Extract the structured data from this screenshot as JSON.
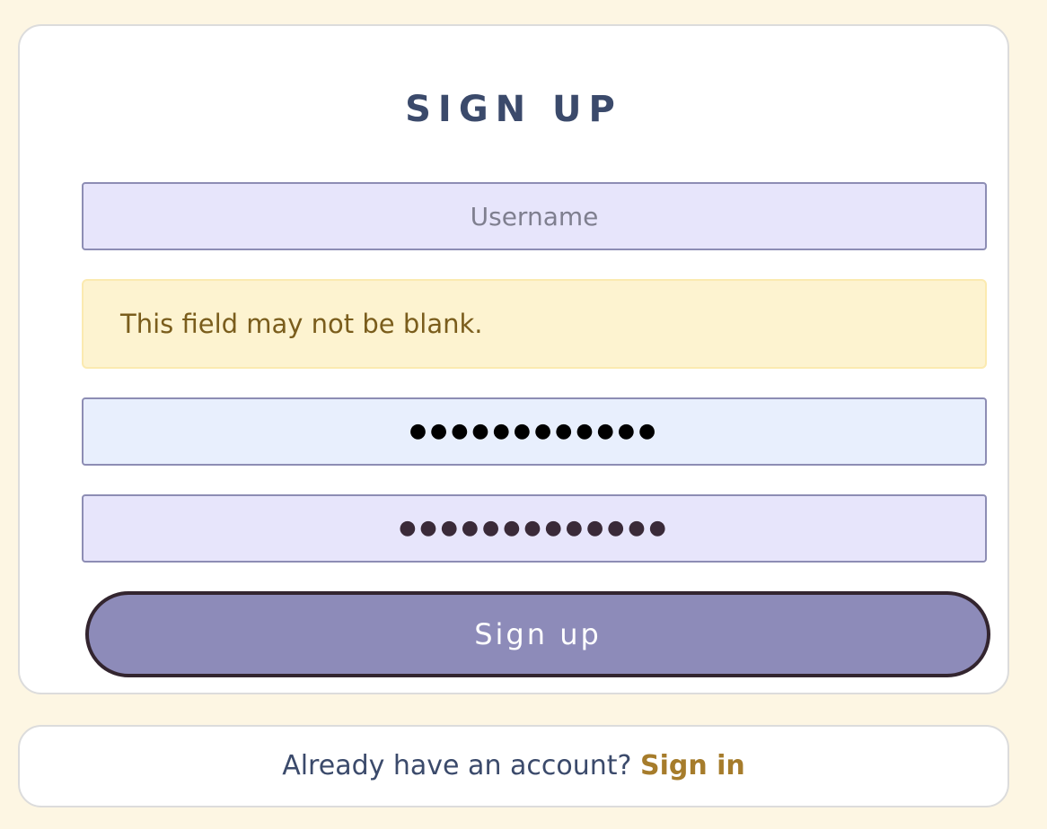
{
  "form": {
    "title": "SIGN UP",
    "username": {
      "placeholder": "Username",
      "value": ""
    },
    "username_error": "This field may not be blank.",
    "password": {
      "value": "●●●●●●●●●●●●"
    },
    "confirm_password": {
      "value": "●●●●●●●●●●●●●"
    },
    "submit_label": "Sign up"
  },
  "footer": {
    "prompt": "Already have an account?",
    "link_label": "Sign in"
  }
}
